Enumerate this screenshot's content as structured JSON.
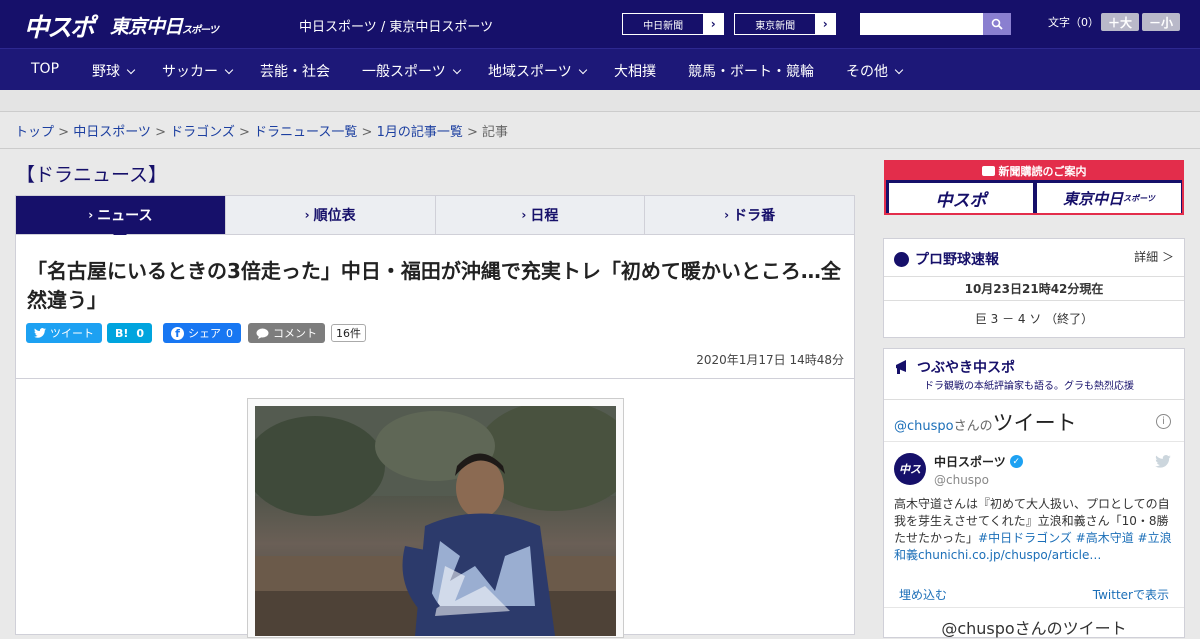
{
  "header": {
    "logo_main": "中スポ",
    "logo_tokyo": "東京中日",
    "logo_tokyo_small": "スポーツ",
    "site_links": "中日スポーツ / 東京中日スポーツ",
    "paper1": "中日新聞",
    "paper2": "東京新聞",
    "font_label": "文字（0）",
    "font_up": "＋大",
    "font_down": "－小"
  },
  "nav": {
    "items": [
      {
        "label": "TOP"
      },
      {
        "label": "野球"
      },
      {
        "label": "サッカー"
      },
      {
        "label": "芸能・社会"
      },
      {
        "label": "一般スポーツ"
      },
      {
        "label": "地域スポーツ"
      },
      {
        "label": "大相撲"
      },
      {
        "label": "競馬・ボート・競輪"
      },
      {
        "label": "その他"
      }
    ]
  },
  "breadcrumb": {
    "items": [
      "トップ",
      "中日スポーツ",
      "ドラゴンズ",
      "ドラニュース一覧",
      "1月の記事一覧"
    ],
    "current": "記事",
    "sep": " > "
  },
  "section": {
    "title": "【ドラニュース】"
  },
  "tabs": [
    {
      "label": "ニュース"
    },
    {
      "label": "順位表"
    },
    {
      "label": "日程"
    },
    {
      "label": "ドラ番"
    }
  ],
  "article": {
    "headline": "「名古屋にいるときの3倍走った」中日・福田が沖縄で充実トレ「初めて暖かいところ…全然違う」",
    "date": "2020年1月17日 14時48分",
    "share": {
      "tweet": "ツイート",
      "hatena_label": "B!",
      "hatena_count": "0",
      "fb_label": "シェア",
      "fb_count": "0",
      "comment": "コメント",
      "comment_count": "16件"
    }
  },
  "sidebar": {
    "ad": {
      "title": "新聞購読のご案内",
      "left": "中スポ",
      "right": "東京中日",
      "right_small": "スポーツ"
    },
    "baseball": {
      "title": "プロ野球速報",
      "detail": "詳細 ＞",
      "timestamp": "10月23日21時42分現在",
      "score": "巨  3 － 4  ソ  （終了）"
    },
    "tsubuyaki": {
      "title": "つぶやき中スポ",
      "subtitle": "ドラ観戦の本紙評論家も語る。グラも熱烈応援",
      "handle_prefix": "@chuspo",
      "handle_suffix": "さんの",
      "tweets_label": "ツイート",
      "account_name": "中日スポーツ",
      "account_handle": "@chuspo",
      "tweet_text": "高木守道さんは『初めて大人扱い、プロとしての自我を芽生えさせてくれた』立浪和義さん「10・8勝たせたかった」",
      "tweet_tags": "#中日ドラゴンズ #高木守道 #立浪和義",
      "tweet_link": "chunichi.co.jp/chuspo/article…",
      "embed": "埋め込む",
      "view_on_twitter": "Twitterで表示",
      "footer": "@chuspoさんのツイート"
    }
  },
  "colors": {
    "brand": "#16106a",
    "nav": "#1d1878",
    "accent": "#e32d4b"
  }
}
